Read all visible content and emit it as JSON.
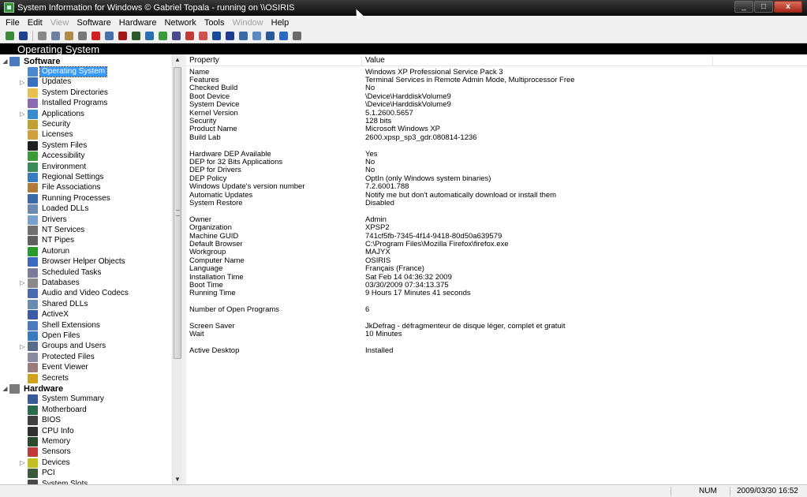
{
  "window": {
    "title": "System Information for Windows  © Gabriel Topala - running on \\\\OSIRIS"
  },
  "window_buttons": [
    "_",
    "□",
    "x"
  ],
  "menu": [
    {
      "label": "File",
      "enabled": true
    },
    {
      "label": "Edit",
      "enabled": true
    },
    {
      "label": "View",
      "enabled": false
    },
    {
      "label": "Software",
      "enabled": true
    },
    {
      "label": "Hardware",
      "enabled": true
    },
    {
      "label": "Network",
      "enabled": true
    },
    {
      "label": "Tools",
      "enabled": true
    },
    {
      "label": "Window",
      "enabled": false
    },
    {
      "label": "Help",
      "enabled": true
    }
  ],
  "toolbar": [
    {
      "icon": "exit-icon",
      "color": "#3a8a3a"
    },
    {
      "icon": "save-icon",
      "color": "#1f3f8f"
    },
    {
      "sep": true
    },
    {
      "icon": "cut-icon",
      "color": "#888888"
    },
    {
      "icon": "copy-icon",
      "color": "#6f7f9f"
    },
    {
      "icon": "paste-icon",
      "color": "#b08a4a"
    },
    {
      "icon": "print-icon",
      "color": "#777777"
    },
    {
      "icon": "stop-icon",
      "color": "#d02020"
    },
    {
      "icon": "message-icon",
      "color": "#4a6fa8"
    },
    {
      "icon": "chart-icon",
      "color": "#a01818"
    },
    {
      "icon": "network-icon",
      "color": "#2a5a2a"
    },
    {
      "icon": "globe-icon",
      "color": "#2a70b0"
    },
    {
      "icon": "refresh-icon",
      "color": "#3a9a3a"
    },
    {
      "icon": "wrench-icon",
      "color": "#4a4a8a"
    },
    {
      "icon": "drive-icon",
      "color": "#c03a3a"
    },
    {
      "icon": "record-icon",
      "color": "#d05050"
    },
    {
      "icon": "history-icon",
      "color": "#1a4a9a"
    },
    {
      "icon": "shield-icon",
      "color": "#203a90"
    },
    {
      "icon": "app-icon",
      "color": "#3a6aa8"
    },
    {
      "icon": "cube-icon",
      "color": "#5a8abf"
    },
    {
      "icon": "monitor-icon",
      "color": "#2a5a9a"
    },
    {
      "icon": "help-icon",
      "color": "#2a6ac0"
    },
    {
      "icon": "web-icon",
      "color": "#6a6a6a"
    }
  ],
  "page_title": "Operating System",
  "tree": {
    "software": {
      "label": "Software",
      "items": [
        {
          "label": "Operating System",
          "icon": "windows-icon",
          "color": "#4a8ad0",
          "selected": true
        },
        {
          "label": "Updates",
          "icon": "updates-icon",
          "color": "#3a70c0",
          "expandable": true
        },
        {
          "label": "System Directories",
          "icon": "folder-icon",
          "color": "#e8c050"
        },
        {
          "label": "Installed Programs",
          "icon": "programs-icon",
          "color": "#8a6ab0"
        },
        {
          "label": "Applications",
          "icon": "applications-icon",
          "color": "#3a8ad0",
          "expandable": true
        },
        {
          "label": "Security",
          "icon": "security-icon",
          "color": "#c0a030"
        },
        {
          "label": "Licenses",
          "icon": "license-icon",
          "color": "#d0a040"
        },
        {
          "label": "System Files",
          "icon": "cmd-icon",
          "color": "#202020"
        },
        {
          "label": "Accessibility",
          "icon": "accessibility-icon",
          "color": "#3a9a3a"
        },
        {
          "label": "Environment",
          "icon": "environment-icon",
          "color": "#3a8a5a"
        },
        {
          "label": "Regional Settings",
          "icon": "regional-icon",
          "color": "#3a7ac0"
        },
        {
          "label": "File Associations",
          "icon": "file-associations-icon",
          "color": "#b07a3a"
        },
        {
          "label": "Running Processes",
          "icon": "processes-icon",
          "color": "#3a6aa8"
        },
        {
          "label": "Loaded DLLs",
          "icon": "dll-icon",
          "color": "#6a8ab0"
        },
        {
          "label": "Drivers",
          "icon": "drivers-icon",
          "color": "#7aa0d0"
        },
        {
          "label": "NT Services",
          "icon": "services-icon",
          "color": "#707070"
        },
        {
          "label": "NT Pipes",
          "icon": "pipes-icon",
          "color": "#606060"
        },
        {
          "label": "Autorun",
          "icon": "autorun-icon",
          "color": "#2a9a2a"
        },
        {
          "label": "Browser Helper Objects",
          "icon": "bho-icon",
          "color": "#3a6ac0"
        },
        {
          "label": "Scheduled Tasks",
          "icon": "tasks-icon",
          "color": "#7a7a9a"
        },
        {
          "label": "Databases",
          "icon": "database-icon",
          "color": "#8a8a8a",
          "expandable": true
        },
        {
          "label": "Audio and Video Codecs",
          "icon": "codecs-icon",
          "color": "#4a6ab0"
        },
        {
          "label": "Shared DLLs",
          "icon": "shared-dll-icon",
          "color": "#6a8ab0"
        },
        {
          "label": "ActiveX",
          "icon": "activex-icon",
          "color": "#3a5aa8"
        },
        {
          "label": "Shell Extensions",
          "icon": "shell-icon",
          "color": "#4a7ac0"
        },
        {
          "label": "Open Files",
          "icon": "open-files-icon",
          "color": "#3a7ac0"
        },
        {
          "label": "Groups and Users",
          "icon": "users-icon",
          "color": "#5a6a8a",
          "expandable": true
        },
        {
          "label": "Protected Files",
          "icon": "protected-icon",
          "color": "#8a8aa0"
        },
        {
          "label": "Event Viewer",
          "icon": "event-icon",
          "color": "#9a7a7a"
        },
        {
          "label": "Secrets",
          "icon": "key-icon",
          "color": "#d0a020"
        }
      ]
    },
    "hardware": {
      "label": "Hardware",
      "items": [
        {
          "label": "System Summary",
          "icon": "summary-icon",
          "color": "#3a5a9a"
        },
        {
          "label": "Motherboard",
          "icon": "motherboard-icon",
          "color": "#2a6a4a"
        },
        {
          "label": "BIOS",
          "icon": "bios-icon",
          "color": "#404040"
        },
        {
          "label": "CPU Info",
          "icon": "cpu-icon",
          "color": "#303030"
        },
        {
          "label": "Memory",
          "icon": "memory-icon",
          "color": "#2a4a2a"
        },
        {
          "label": "Sensors",
          "icon": "sensors-icon",
          "color": "#c03a3a"
        },
        {
          "label": "Devices",
          "icon": "devices-icon",
          "color": "#c0c020",
          "expandable": true
        },
        {
          "label": "PCI",
          "icon": "pci-icon",
          "color": "#3a5a3a"
        },
        {
          "label": "System Slots",
          "icon": "slots-icon",
          "color": "#4a4a4a"
        }
      ]
    }
  },
  "list": {
    "columns": [
      "Property",
      "Value"
    ],
    "groups": [
      {
        "rows": [
          [
            "Name",
            "Windows XP Professional Service Pack 3"
          ],
          [
            "Features",
            "Terminal Services in Remote Admin Mode, Multiprocessor Free"
          ],
          [
            "Checked Build",
            "No"
          ],
          [
            "Boot Device",
            "\\Device\\HarddiskVolume9"
          ],
          [
            "System Device",
            "\\Device\\HarddiskVolume9"
          ],
          [
            "Kernel Version",
            "5.1.2600.5657"
          ],
          [
            "Security",
            "128 bits"
          ],
          [
            "Product Name",
            "Microsoft Windows XP"
          ],
          [
            "Build Lab",
            "2600.xpsp_sp3_gdr.080814-1236"
          ]
        ]
      },
      {
        "rows": [
          [
            "Hardware DEP Available",
            "Yes"
          ],
          [
            "DEP for 32 Bits Applications",
            "No"
          ],
          [
            "DEP for Drivers",
            "No"
          ],
          [
            "DEP Policy",
            "OptIn (only Windows system binaries)"
          ],
          [
            "Windows Update's version number",
            "7.2.6001.788"
          ],
          [
            "Automatic Updates",
            "Notify me but don't automatically download or install them"
          ],
          [
            "System Restore",
            "Disabled"
          ]
        ]
      },
      {
        "rows": [
          [
            "Owner",
            "Admin"
          ],
          [
            "Organization",
            "XPSP2"
          ],
          [
            "Machine GUID",
            "741cf5fb-7345-4f14-9418-80d50a639579"
          ],
          [
            "Default Browser",
            "C:\\Program Files\\Mozilla Firefox\\firefox.exe"
          ],
          [
            "Workgroup",
            "MAJYX"
          ],
          [
            "Computer Name",
            "OSIRIS"
          ],
          [
            "Language",
            "Français (France)"
          ],
          [
            "Installation Time",
            "Sat Feb 14 04:36:32 2009"
          ],
          [
            "Boot Time",
            "03/30/2009   07:34:13.375"
          ],
          [
            "Running Time",
            "9 Hours 17 Minutes 41 seconds"
          ]
        ]
      },
      {
        "rows": [
          [
            "Number of Open Programs",
            "6"
          ]
        ]
      },
      {
        "rows": [
          [
            "Screen Saver",
            "JkDefrag - défragmenteur de disque léger, complet et gratuit"
          ],
          [
            "Wait",
            "10 Minutes"
          ]
        ]
      },
      {
        "rows": [
          [
            "Active Desktop",
            "Installed"
          ]
        ]
      }
    ]
  },
  "status": {
    "num": "NUM",
    "datetime": "2009/03/30 16:52"
  }
}
